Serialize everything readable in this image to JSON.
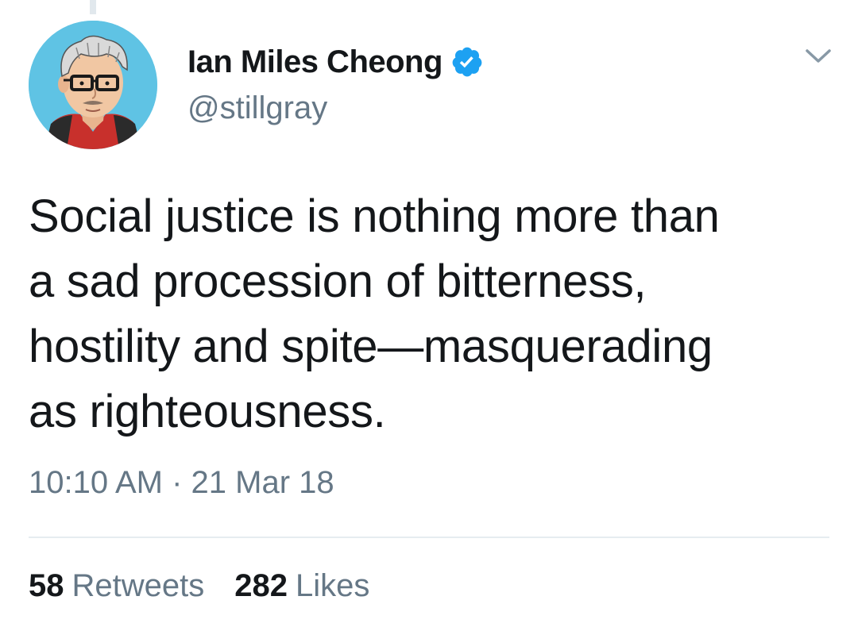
{
  "tweet": {
    "author": {
      "display_name": "Ian Miles Cheong",
      "handle": "@stillgray",
      "verified": true,
      "avatar_icon": "cartoon-avatar-icon"
    },
    "text_lines": [
      "Social justice is nothing more than",
      "a sad procession of bitterness,",
      "hostility and spite—masquerading",
      "as righteousness."
    ],
    "timestamp": "10:10 AM · 21 Mar 18",
    "stats": {
      "retweets_count": "58",
      "retweets_label": "Retweets",
      "likes_count": "282",
      "likes_label": "Likes"
    }
  },
  "icons": {
    "verified": "verified-badge-icon",
    "menu": "chevron-down-icon"
  },
  "colors": {
    "text_primary": "#14171a",
    "text_secondary": "#657786",
    "verified_blue": "#1da1f2",
    "divider": "#e6ecf0",
    "avatar_background": "#5fc3e4"
  }
}
